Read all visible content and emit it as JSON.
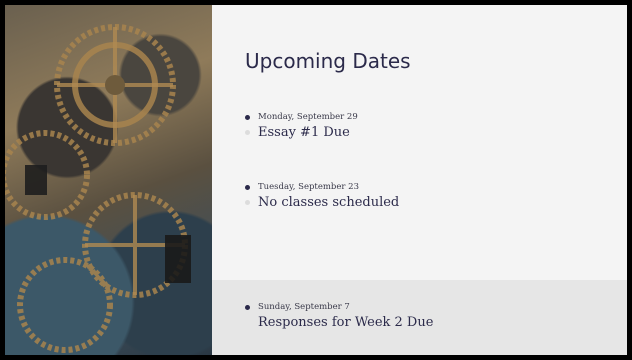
{
  "slide": {
    "title": "Upcoming Dates",
    "items": [
      {
        "date": "Monday, September 29",
        "event": "Essay #1 Due"
      },
      {
        "date": "Tuesday, September 23",
        "event": "No classes scheduled"
      },
      {
        "date": "Sunday, September 7",
        "event": "Responses for Week 2 Due"
      }
    ]
  },
  "colors": {
    "background": "#f4f4f4",
    "text": "#2b2a4a",
    "highlight_band": "#e6e6e6",
    "frame": "#000000"
  },
  "icons": {
    "image": "brass-gears-photo",
    "bullet": "bullet-dot-icon"
  }
}
